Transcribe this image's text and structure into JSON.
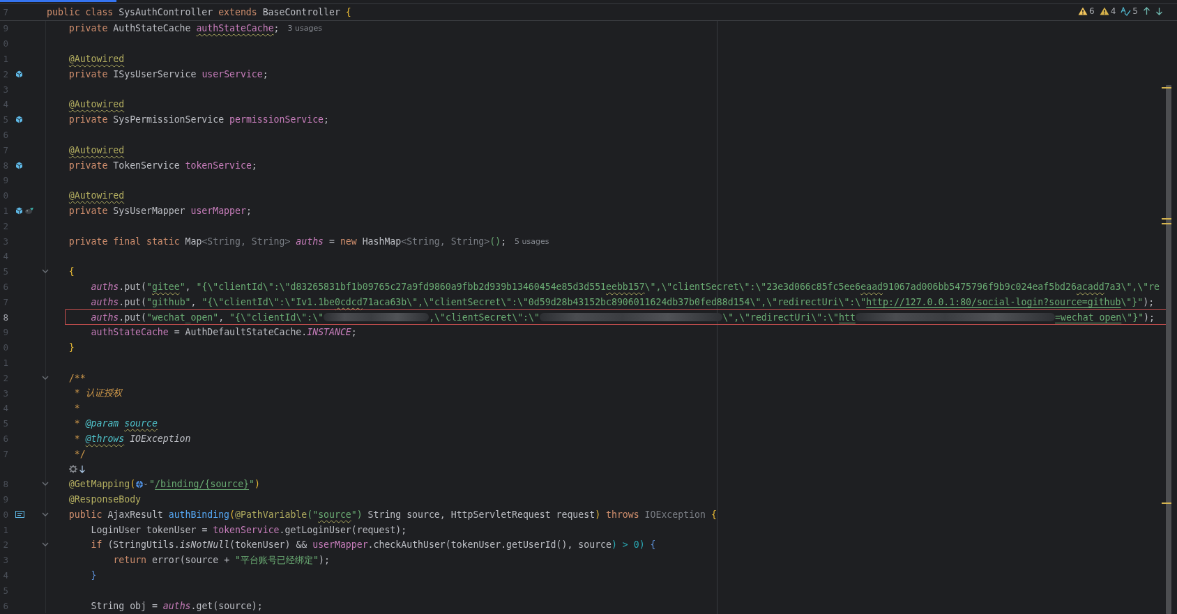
{
  "editor": {
    "sticky_line": {
      "number": "7",
      "tokens": [
        {
          "kind": "kw",
          "text": "public class "
        },
        {
          "kind": "plain",
          "text": "SysAuthController "
        },
        {
          "kind": "kw",
          "text": "extends "
        },
        {
          "kind": "plain",
          "text": "BaseController "
        },
        {
          "kind": "bracket_gold",
          "text": "{"
        }
      ]
    },
    "inspections": [
      {
        "kind": "warning",
        "count": "6"
      },
      {
        "kind": "weak_warning",
        "count": "4"
      },
      {
        "kind": "typo",
        "count": "5"
      }
    ],
    "lines": [
      {
        "number": "9",
        "outlined": false,
        "tokens": [
          {
            "kind": "kw",
            "text": "private "
          },
          {
            "kind": "plain",
            "text": "AuthStateCache "
          },
          {
            "kind": "field",
            "text": "authStateCache",
            "typo": true
          },
          {
            "kind": "plain",
            "text": ";"
          },
          {
            "kind": "hint",
            "text": "3 usages"
          }
        ]
      },
      {
        "number": "0",
        "outlined": false
      },
      {
        "number": "1",
        "outlined": false,
        "tokens": [
          {
            "kind": "ann",
            "text": "@Autowired",
            "typo": true
          }
        ]
      },
      {
        "number": "2",
        "outlined": false,
        "gutter": [
          {
            "kind": "bean"
          }
        ],
        "tokens": [
          {
            "kind": "kw",
            "text": "private "
          },
          {
            "kind": "plain",
            "text": "ISysUserService "
          },
          {
            "kind": "field",
            "text": "userService"
          },
          {
            "kind": "plain",
            "text": ";"
          }
        ]
      },
      {
        "number": "3",
        "outlined": false
      },
      {
        "number": "4",
        "outlined": false,
        "tokens": [
          {
            "kind": "ann",
            "text": "@Autowired",
            "typo": true
          }
        ]
      },
      {
        "number": "5",
        "outlined": false,
        "gutter": [
          {
            "kind": "bean"
          }
        ],
        "tokens": [
          {
            "kind": "kw",
            "text": "private "
          },
          {
            "kind": "plain",
            "text": "SysPermissionService "
          },
          {
            "kind": "field",
            "text": "permissionService"
          },
          {
            "kind": "plain",
            "text": ";"
          }
        ]
      },
      {
        "number": "6",
        "outlined": false
      },
      {
        "number": "7",
        "outlined": false,
        "tokens": [
          {
            "kind": "ann",
            "text": "@Autowired",
            "typo": true
          }
        ]
      },
      {
        "number": "8",
        "outlined": false,
        "gutter": [
          {
            "kind": "bean"
          }
        ],
        "tokens": [
          {
            "kind": "kw",
            "text": "private "
          },
          {
            "kind": "plain",
            "text": "TokenService "
          },
          {
            "kind": "field",
            "text": "tokenService"
          },
          {
            "kind": "plain",
            "text": ";"
          }
        ]
      },
      {
        "number": "9",
        "outlined": false
      },
      {
        "number": "0",
        "outlined": false,
        "tokens": [
          {
            "kind": "ann",
            "text": "@Autowired",
            "typo": true
          }
        ]
      },
      {
        "number": "1",
        "outlined": false,
        "gutter": [
          {
            "kind": "bean"
          },
          {
            "kind": "mapper"
          }
        ],
        "tokens": [
          {
            "kind": "kw",
            "text": "private "
          },
          {
            "kind": "plain",
            "text": "SysUserMapper "
          },
          {
            "kind": "field",
            "text": "userMapper"
          },
          {
            "kind": "plain",
            "text": ";"
          }
        ]
      },
      {
        "number": "2",
        "outlined": false
      },
      {
        "number": "3",
        "outlined": false,
        "tokens": [
          {
            "kind": "kw",
            "text": "private final static "
          },
          {
            "kind": "plain",
            "text": "Map"
          },
          {
            "kind": "dim",
            "text": "<String, String> "
          },
          {
            "kind": "static",
            "text": "auths"
          },
          {
            "kind": "plain",
            "text": " = "
          },
          {
            "kind": "kw",
            "text": "new "
          },
          {
            "kind": "plain",
            "text": "HashMap"
          },
          {
            "kind": "dim",
            "text": "<String, String>"
          },
          {
            "kind": "str",
            "text": "()"
          },
          {
            "kind": "plain",
            "text": ";"
          },
          {
            "kind": "hint",
            "text": "5 usages"
          }
        ]
      },
      {
        "number": "4",
        "outlined": false
      },
      {
        "number": "5",
        "outlined": false,
        "fold": true,
        "tokens": [
          {
            "kind": "bracket_gold",
            "text": "{"
          }
        ],
        "children": [
          {
            "number": "6",
            "outlined": false,
            "tokens": [
              {
                "kind": "static",
                "text": "auths"
              },
              {
                "kind": "plain",
                "text": ".put("
              },
              {
                "kind": "str",
                "text": "\""
              },
              {
                "kind": "str",
                "text": "gitee",
                "typo": true
              },
              {
                "kind": "str",
                "text": "\""
              },
              {
                "kind": "plain",
                "text": ", "
              },
              {
                "kind": "str",
                "text": "\"{\\\"clientId\\\":\\\"d83265831bf1b09765c27a9fd9860a9fbb2d939b13460454e85d3d551"
              },
              {
                "kind": "str",
                "text": "eebb157",
                "typo": true
              },
              {
                "kind": "str",
                "text": "\\\",\\\"clientSecret\\\":\\\"23e3d066c85fc5ee6"
              },
              {
                "kind": "str",
                "text": "eaad",
                "typo": true
              },
              {
                "kind": "str",
                "text": "91067ad006bb5475796f9b9c024eaf5bd26"
              },
              {
                "kind": "str",
                "text": "acadd",
                "typo": true
              },
              {
                "kind": "str",
                "text": "7a3\\\",\\\"re"
              }
            ]
          },
          {
            "number": "7",
            "outlined": false,
            "tokens": [
              {
                "kind": "static",
                "text": "auths"
              },
              {
                "kind": "plain",
                "text": ".put("
              },
              {
                "kind": "str",
                "text": "\"github\""
              },
              {
                "kind": "plain",
                "text": ", "
              },
              {
                "kind": "str",
                "text": "\"{\\\"clientId\\\":\\\"Iv1.1be"
              },
              {
                "kind": "str",
                "text": "0cdcd",
                "typo": true
              },
              {
                "kind": "str",
                "text": "71aca63b\\\",\\\"clientSecret\\\":\\\"0d59d28b43152bc8906011624db37b0fed88d154\\\",\\\"redirectUri\\\":\\\""
              },
              {
                "kind": "link",
                "text": "http://127.0.0.1:80/social-login?source=github"
              },
              {
                "kind": "str",
                "text": "\\\"}\""
              },
              {
                "kind": "plain",
                "text": ");"
              }
            ]
          },
          {
            "number": "8",
            "outlined": true,
            "tokens": [
              {
                "kind": "static",
                "text": "auths"
              },
              {
                "kind": "plain",
                "text": ".put("
              },
              {
                "kind": "str",
                "text": "\"wechat_open\""
              },
              {
                "kind": "plain",
                "text": ", "
              },
              {
                "kind": "str",
                "text": "\"{\\\"clientId\\\":\\\""
              },
              {
                "kind": "blur_short"
              },
              {
                "kind": "str",
                "text": ",\\\"clientSecret\\\":\\\""
              },
              {
                "kind": "blur_medium"
              },
              {
                "kind": "str",
                "text": "\\\",\\\"redirectUri\\\":\\\""
              },
              {
                "kind": "link",
                "text": "htt"
              },
              {
                "kind": "blur_long"
              },
              {
                "kind": "link",
                "text": "=wechat_open"
              },
              {
                "kind": "str",
                "text": "\\\"}\""
              },
              {
                "kind": "plain",
                "text": ");"
              }
            ]
          },
          {
            "number": "9",
            "outlined": false,
            "tokens": [
              {
                "kind": "field",
                "text": "authStateCache"
              },
              {
                "kind": "plain",
                "text": " = AuthDefaultStateCache."
              },
              {
                "kind": "static",
                "text": "INSTANCE"
              },
              {
                "kind": "plain",
                "text": ";"
              }
            ]
          }
        ]
      },
      {
        "number": "0",
        "outlined": false,
        "tokens": [
          {
            "kind": "bracket_gold",
            "text": "}"
          }
        ]
      },
      {
        "number": "1",
        "outlined": false
      },
      {
        "number": "2",
        "outlined": false,
        "fold": true,
        "tokens": [
          {
            "kind": "doc",
            "text": "/**"
          }
        ]
      },
      {
        "number": "3",
        "outlined": false,
        "tokens": [
          {
            "kind": "doc",
            "text": " * "
          },
          {
            "kind": "doc_text",
            "text": "认证授权"
          }
        ]
      },
      {
        "number": "4",
        "outlined": false,
        "tokens": [
          {
            "kind": "doc",
            "text": " *"
          }
        ]
      },
      {
        "number": "5",
        "outlined": false,
        "tokens": [
          {
            "kind": "doc",
            "text": " * "
          },
          {
            "kind": "doctag",
            "text": "@param "
          },
          {
            "kind": "doctag",
            "text": "source",
            "typo": true
          }
        ]
      },
      {
        "number": "6",
        "outlined": false,
        "tokens": [
          {
            "kind": "doc",
            "text": " * "
          },
          {
            "kind": "doctag",
            "text": "@throws",
            "typo": true
          },
          {
            "kind": "italic",
            "text": " IOException"
          }
        ]
      },
      {
        "number": "7",
        "outlined": false,
        "tokens": [
          {
            "kind": "doc",
            "text": " */"
          }
        ]
      },
      {
        "outlined": false,
        "tokens": [
          {
            "kind": "gear"
          },
          {
            "kind": "down_arrow"
          }
        ]
      },
      {
        "number": "8",
        "outlined": false,
        "fold": true,
        "tokens": [
          {
            "kind": "ann",
            "text": "@GetMapping"
          },
          {
            "kind": "bracket_gold",
            "text": "("
          },
          {
            "kind": "globe"
          },
          {
            "kind": "str",
            "text": "\""
          },
          {
            "kind": "link",
            "text": "/binding/{source}"
          },
          {
            "kind": "str",
            "text": "\""
          },
          {
            "kind": "bracket_gold",
            "text": ")"
          }
        ]
      },
      {
        "number": "9",
        "outlined": false,
        "tokens": [
          {
            "kind": "ann",
            "text": "@ResponseBody"
          }
        ]
      },
      {
        "number": "0",
        "outlined": false,
        "fold": true,
        "gutter": [
          {
            "kind": "endpoint"
          }
        ],
        "tokens": [
          {
            "kind": "kw",
            "text": "public "
          },
          {
            "kind": "plain",
            "text": "AjaxResult "
          },
          {
            "kind": "method",
            "text": "authBinding"
          },
          {
            "kind": "bracket_gold",
            "text": "("
          },
          {
            "kind": "ann",
            "text": "@PathVariable"
          },
          {
            "kind": "str",
            "text": "(\""
          },
          {
            "kind": "str",
            "text": "source",
            "typo": true
          },
          {
            "kind": "str",
            "text": "\")"
          },
          {
            "kind": "plain",
            "text": " String source, HttpServletRequest request"
          },
          {
            "kind": "bracket_gold",
            "text": ")"
          },
          {
            "kind": "kw",
            "text": " throws "
          },
          {
            "kind": "dim",
            "text": "IOException "
          },
          {
            "kind": "bracket_gold",
            "text": "{"
          }
        ],
        "children": [
          {
            "number": "1",
            "outlined": false,
            "tokens": [
              {
                "kind": "plain",
                "text": "LoginUser tokenUser = "
              },
              {
                "kind": "field",
                "text": "tokenService"
              },
              {
                "kind": "plain",
                "text": ".getLoginUser(request);"
              }
            ]
          },
          {
            "number": "2",
            "outlined": false,
            "fold": true,
            "tokens": [
              {
                "kind": "kw",
                "text": "if "
              },
              {
                "kind": "plain",
                "text": "(StringUtils."
              },
              {
                "kind": "italic",
                "text": "isNotNull"
              },
              {
                "kind": "plain",
                "text": "(tokenUser) && "
              },
              {
                "kind": "field",
                "text": "userMapper"
              },
              {
                "kind": "plain",
                "text": ".checkAuthUser(tokenUser.getUserId(), source"
              },
              {
                "kind": "num",
                "text": ") > 0)"
              },
              {
                "kind": "bracket_blue",
                "text": " {"
              }
            ],
            "children": [
              {
                "number": "3",
                "outlined": false,
                "tokens": [
                  {
                    "kind": "kw",
                    "text": "return "
                  },
                  {
                    "kind": "plain",
                    "text": "error(source + "
                  },
                  {
                    "kind": "str",
                    "text": "\"平台账号已经绑定\""
                  },
                  {
                    "kind": "plain",
                    "text": ");"
                  }
                ]
              }
            ]
          },
          {
            "number": "4",
            "outlined": false,
            "tokens": [
              {
                "kind": "bracket_blue",
                "text": "}"
              }
            ]
          },
          {
            "number": "5",
            "outlined": false
          },
          {
            "number": "6",
            "outlined": false,
            "tokens": [
              {
                "kind": "plain",
                "text": "String obj = "
              },
              {
                "kind": "static",
                "text": "auths"
              },
              {
                "kind": "plain",
                "text": ".get(source);"
              }
            ]
          }
        ]
      }
    ]
  }
}
